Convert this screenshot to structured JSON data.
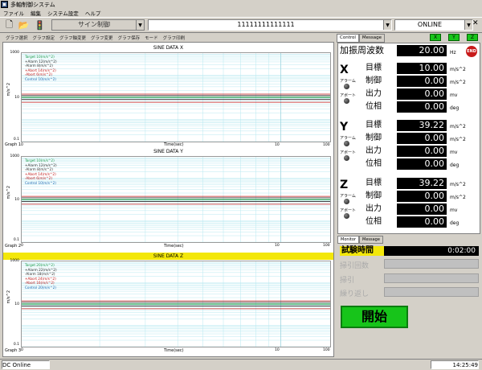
{
  "app": {
    "title": "多軸制御システム"
  },
  "menu": [
    "ファイル",
    "編集",
    "システム設定",
    "ヘルプ"
  ],
  "toolbar": {
    "mode": "サイン制御",
    "file": "11111111111111",
    "connection": "ONLINE"
  },
  "left_tabs": [
    "グラフ選択",
    "グラフ設定",
    "グラフ軸変更",
    "グラフ変更",
    "グラフ保存",
    "モード",
    "グラフ印刷"
  ],
  "graphs": [
    {
      "title": "SINE DATA X",
      "ylabel": "m/s^2",
      "xlabel": "Time(sec)",
      "glabel": "Graph 1",
      "legend": [
        "Target 10(m/s^2)",
        "+Alarm 12(m/s^2)",
        "-Alarm 8(m/s^2)",
        "+Abort 14(m/s^2)",
        "-Abort 6(m/s^2)",
        "Control 10(m/s^2)"
      ]
    },
    {
      "title": "SINE DATA Y",
      "ylabel": "m/s^2",
      "xlabel": "Time(sec)",
      "glabel": "Graph 2",
      "legend": [
        "Target 10(m/s^2)",
        "+Alarm 12(m/s^2)",
        "-Alarm 8(m/s^2)",
        "+Abort 14(m/s^2)",
        "-Abort 6(m/s^2)",
        "Control 10(m/s^2)"
      ]
    },
    {
      "title": "SINE DATA Z",
      "ylabel": "m/s^2",
      "xlabel": "Time(sec)",
      "glabel": "Graph 3",
      "legend": [
        "Target 20(m/s^2)",
        "+Alarm 22(m/s^2)",
        "-Alarm 18(m/s^2)",
        "+Abort 24(m/s^2)",
        "-Abort 16(m/s^2)",
        "Control 20(m/s^2)"
      ]
    }
  ],
  "axis": {
    "y": [
      "1000",
      "10",
      "0.1"
    ],
    "x": [
      "0",
      "10",
      "100"
    ]
  },
  "right_tabs": [
    "Control",
    "Message"
  ],
  "leds": [
    "X",
    "Y",
    "Z"
  ],
  "freq": {
    "label": "加振周波数",
    "value": "20.00",
    "unit": "Hz",
    "end": "END"
  },
  "axes": [
    {
      "name": "X",
      "target": "10.00",
      "control": "0.00",
      "output": "0.00",
      "phase": "0.00"
    },
    {
      "name": "Y",
      "target": "39.22",
      "control": "0.00",
      "output": "0.00",
      "phase": "0.00"
    },
    {
      "name": "Z",
      "target": "39.22",
      "control": "0.00",
      "output": "0.00",
      "phase": "0.00"
    }
  ],
  "row_labels": {
    "target": "目標",
    "control": "制御",
    "output": "出力",
    "phase": "位相",
    "alarm": "アラーム",
    "abort": "アボート"
  },
  "units": {
    "accel": "m/s^2",
    "mv": "mv",
    "deg": "deg"
  },
  "bottom_tabs": [
    "Monitor",
    "Message"
  ],
  "timer": {
    "label": "試験時間",
    "value": "0:02:00"
  },
  "dim_labels": [
    "掃引回数",
    "掃引",
    "繰り返し"
  ],
  "start_label": "開始",
  "status": {
    "left": "DC Online",
    "time": "14:25:49"
  },
  "colors": {
    "target": "#1a9a4a",
    "alarm": "#2b2b2b",
    "abort": "#c01818",
    "control": "#1a6ab4",
    "grid": "#b8e8f0",
    "highlight": "#f3e70a",
    "start": "#17c41a"
  }
}
